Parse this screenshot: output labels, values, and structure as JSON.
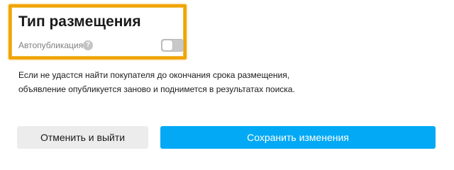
{
  "placement": {
    "title": "Тип размещения",
    "autopublish_label": "Автопубликация",
    "help_icon_glyph": "?",
    "help_icon": "question-circle-icon",
    "autopublish_enabled": false,
    "description": "Если не удастся найти покупателя до окончания срока размещения, объявление опубликуется заново и поднимется в результатах поиска."
  },
  "actions": {
    "cancel_label": "Отменить и выйти",
    "save_label": "Сохранить изменения"
  },
  "colors": {
    "highlight": "#f2a400",
    "save_button": "#03a9f4",
    "cancel_button": "#ececec",
    "toggle_off": "#c8c8c8"
  }
}
